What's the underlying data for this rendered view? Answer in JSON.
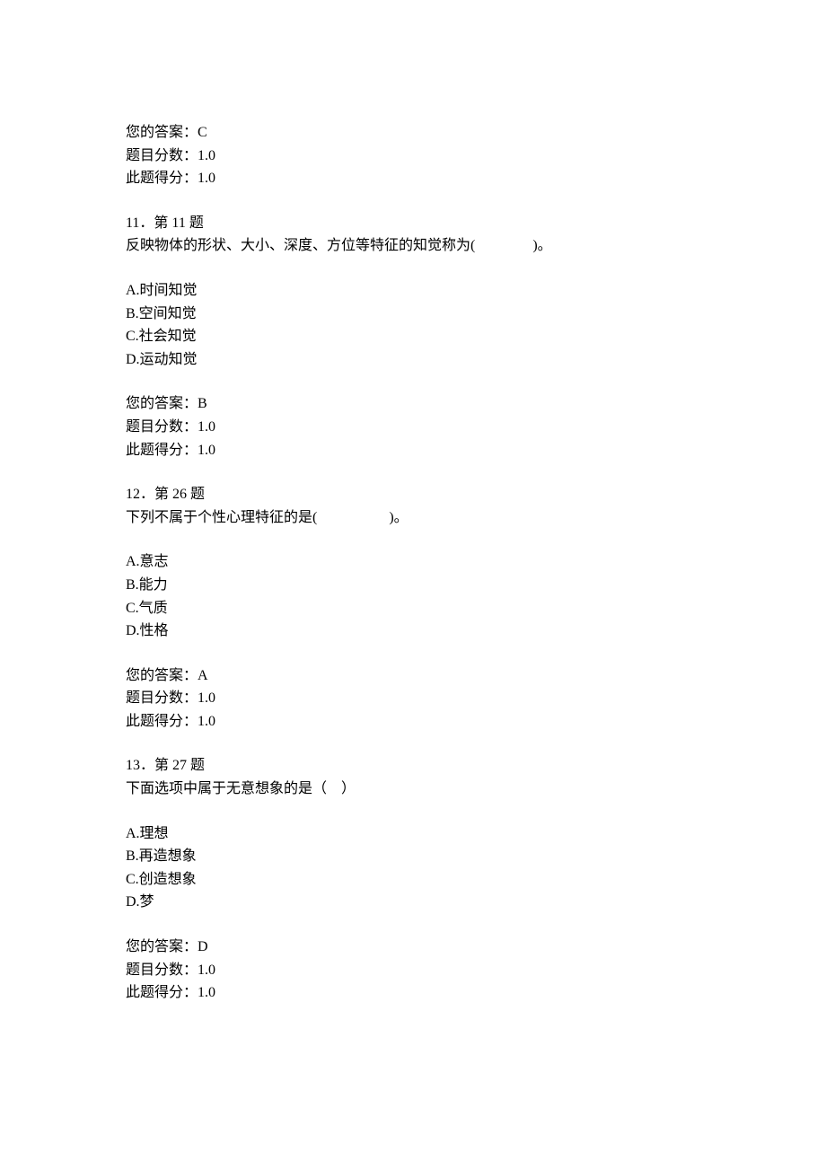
{
  "prev_answer": {
    "your_answer_label": "您的答案：",
    "your_answer_value": "C",
    "score_label": "题目分数：",
    "score_value": "1.0",
    "earned_label": "此题得分：",
    "earned_value": "1.0"
  },
  "questions": [
    {
      "number_line": "11．第 11 题",
      "stem": "反映物体的形状、大小、深度、方位等特征的知觉称为(                )。",
      "options": [
        "A.时间知觉",
        "B.空间知觉",
        "C.社会知觉",
        "D.运动知觉"
      ],
      "your_answer_label": "您的答案：",
      "your_answer_value": "B",
      "score_label": "题目分数：",
      "score_value": "1.0",
      "earned_label": "此题得分：",
      "earned_value": "1.0"
    },
    {
      "number_line": "12．第 26 题",
      "stem": "下列不属于个性心理特征的是(                    )。",
      "options": [
        "A.意志",
        "B.能力",
        "C.气质",
        "D.性格"
      ],
      "your_answer_label": "您的答案：",
      "your_answer_value": "A",
      "score_label": "题目分数：",
      "score_value": "1.0",
      "earned_label": "此题得分：",
      "earned_value": "1.0"
    },
    {
      "number_line": "13．第 27 题",
      "stem": "下面选项中属于无意想象的是（    ）",
      "options": [
        "A.理想",
        "B.再造想象",
        "C.创造想象",
        "D.梦"
      ],
      "your_answer_label": "您的答案：",
      "your_answer_value": "D",
      "score_label": "题目分数：",
      "score_value": "1.0",
      "earned_label": "此题得分：",
      "earned_value": "1.0"
    }
  ]
}
